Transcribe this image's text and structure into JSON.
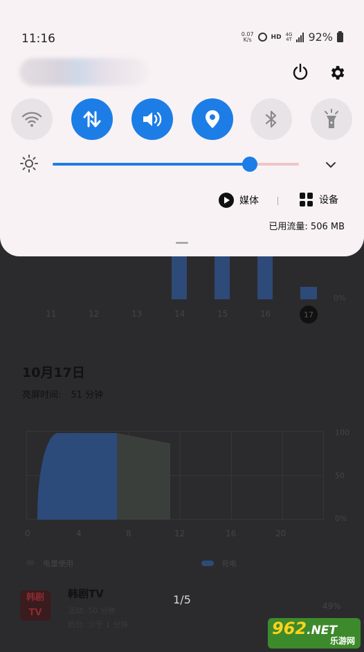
{
  "status_bar": {
    "time": "11:16",
    "net_speed_value": "0.07",
    "net_speed_unit": "K/s",
    "hd": "HD",
    "network": "4G",
    "network_sub": "4T",
    "battery": "92%"
  },
  "quick_tiles": [
    {
      "name": "wifi",
      "icon": "wifi-icon",
      "active": false
    },
    {
      "name": "mobile-data",
      "icon": "data-arrows-icon",
      "active": true
    },
    {
      "name": "sound",
      "icon": "volume-icon",
      "active": true
    },
    {
      "name": "location",
      "icon": "location-pin-icon",
      "active": true
    },
    {
      "name": "bluetooth",
      "icon": "bluetooth-icon",
      "active": false
    },
    {
      "name": "flashlight",
      "icon": "flashlight-icon",
      "active": false
    }
  ],
  "brightness": {
    "level": 0.8
  },
  "panel": {
    "media_label": "媒体",
    "devices_label": "设备",
    "data_usage": "已用流量: 506 MB"
  },
  "colors": {
    "accent": "#1d7de6",
    "panel_bg": "#f8f2f5"
  },
  "background_app": {
    "week_labels": [
      "11",
      "12",
      "13",
      "14",
      "15",
      "16",
      "17"
    ],
    "percent_top": "0%",
    "date_title": "10月17日",
    "screen_time_label": "亮屏时间:",
    "screen_time_value": "51 分钟",
    "y_labels": [
      "100",
      "50",
      "0%"
    ],
    "x_labels": [
      "0",
      "4",
      "8",
      "12",
      "16",
      "20"
    ],
    "legend": [
      "电量使用",
      "充电"
    ],
    "app": {
      "icon_text_top": "韩剧",
      "icon_text_bottom": "TV",
      "name": "韩剧TV",
      "line1": "活动: 50 分钟",
      "line2": "后台: 少于 1 分钟",
      "percent": "49%"
    },
    "pager": "1/5"
  },
  "watermark": {
    "brand": "962",
    "tld": ".NET",
    "sub": "乐游网"
  }
}
